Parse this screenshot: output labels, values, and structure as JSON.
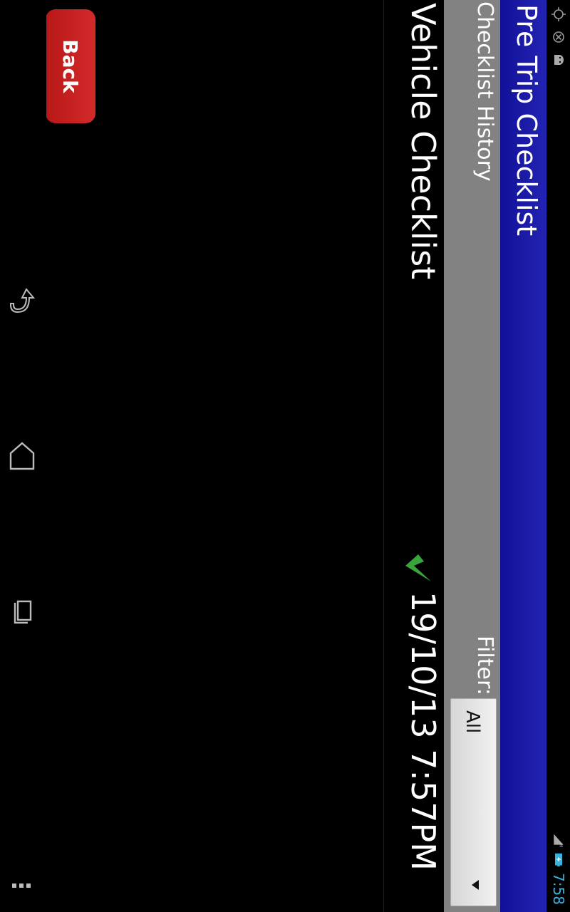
{
  "status_bar": {
    "time": "7:58",
    "icons": [
      "gps-icon",
      "no-sim-icon",
      "android-icon",
      "signal-icon",
      "battery-charging-icon"
    ],
    "network_type": "H"
  },
  "app": {
    "title": "Pre Trip Checklist"
  },
  "header": {
    "title": "Checklist History",
    "filter_label": "Filter:",
    "filter_value": "All"
  },
  "list": {
    "items": [
      {
        "title": "Vehicle Checklist",
        "date": "19/10/13 7:57PM",
        "status_icon": "check-icon",
        "status_color": "#3aa53a"
      }
    ]
  },
  "actions": {
    "back_label": "Back",
    "back_color": "#c81e1e"
  },
  "nav_bar": {
    "icons": [
      "back-nav-icon",
      "home-nav-icon",
      "recents-nav-icon",
      "menu-overflow-icon"
    ]
  }
}
